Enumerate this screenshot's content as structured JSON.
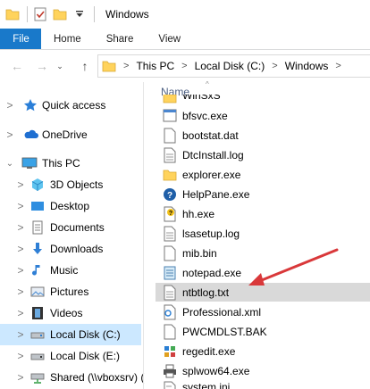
{
  "window": {
    "title": "Windows"
  },
  "ribbon": {
    "tabs": [
      "File",
      "Home",
      "Share",
      "View"
    ]
  },
  "address": {
    "crumbs": [
      "This PC",
      "Local Disk (C:)",
      "Windows"
    ]
  },
  "nav_pane": {
    "items": [
      {
        "label": "Quick access",
        "icon": "star-icon"
      },
      {
        "label": "OneDrive",
        "icon": "cloud-icon"
      },
      {
        "label": "This PC",
        "icon": "computer-icon"
      },
      {
        "label": "3D Objects",
        "icon": "cube-icon"
      },
      {
        "label": "Desktop",
        "icon": "desktop-icon"
      },
      {
        "label": "Documents",
        "icon": "documents-icon"
      },
      {
        "label": "Downloads",
        "icon": "downloads-icon"
      },
      {
        "label": "Music",
        "icon": "music-icon"
      },
      {
        "label": "Pictures",
        "icon": "pictures-icon"
      },
      {
        "label": "Videos",
        "icon": "videos-icon"
      },
      {
        "label": "Local Disk (C:)",
        "icon": "drive-icon",
        "selected": true
      },
      {
        "label": "Local Disk (E:)",
        "icon": "drive-icon"
      },
      {
        "label": "Shared (\\\\vboxsrv) (",
        "icon": "network-drive-icon"
      }
    ]
  },
  "file_list": {
    "column_header": "Name",
    "files": [
      {
        "name": "WinSxS",
        "icon": "folder-icon"
      },
      {
        "name": "bfsvc.exe",
        "icon": "exe-icon"
      },
      {
        "name": "bootstat.dat",
        "icon": "file-icon"
      },
      {
        "name": "DtcInstall.log",
        "icon": "text-file-icon"
      },
      {
        "name": "explorer.exe",
        "icon": "folder-icon"
      },
      {
        "name": "HelpPane.exe",
        "icon": "help-icon"
      },
      {
        "name": "hh.exe",
        "icon": "help-file-icon"
      },
      {
        "name": "lsasetup.log",
        "icon": "text-file-icon"
      },
      {
        "name": "mib.bin",
        "icon": "file-icon"
      },
      {
        "name": "notepad.exe",
        "icon": "notepad-icon"
      },
      {
        "name": "ntbtlog.txt",
        "icon": "text-file-icon",
        "highlighted": true
      },
      {
        "name": "Professional.xml",
        "icon": "xml-icon"
      },
      {
        "name": "PWCMDLST.BAK",
        "icon": "file-icon"
      },
      {
        "name": "regedit.exe",
        "icon": "regedit-icon"
      },
      {
        "name": "splwow64.exe",
        "icon": "printer-icon"
      },
      {
        "name": "system.ini",
        "icon": "ini-icon"
      }
    ]
  },
  "colors": {
    "accent": "#1979ca",
    "selection": "#cce8ff",
    "highlight": "#d9d9d9",
    "arrow": "#d9383a"
  }
}
